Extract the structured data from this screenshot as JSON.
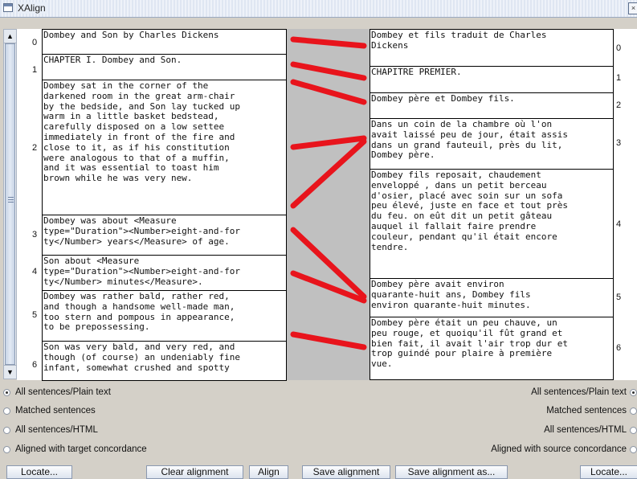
{
  "window": {
    "title": "XAlign"
  },
  "source": {
    "numbers": [
      "0",
      "1",
      "2",
      "3",
      "4",
      "5",
      "6"
    ],
    "sentences": [
      "Dombey and Son by Charles Dickens",
      "CHAPTER I. Dombey and Son.",
      "Dombey sat in the corner of the\ndarkened room in the great arm-chair\nby the bedside, and Son lay tucked up\nwarm in a little basket bedstead,\ncarefully disposed on a low settee\nimmediately in front of the fire and\nclose to it, as if his constitution\nwere analogous to that of a muffin,\nand it was essential to toast him\nbrown while he was very new.",
      "Dombey was about <Measure\ntype=\"Duration\"><Number>eight-and-for\nty</Number> years</Measure> of age.",
      "Son about <Measure\ntype=\"Duration\"><Number>eight-and-for\nty</Number> minutes</Measure>.",
      "Dombey was rather bald, rather red,\nand though a handsome well-made man,\ntoo stern and pompous in appearance,\nto be prepossessing.",
      "Son was very bald, and very red, and\nthough (of course) an undeniably fine\ninfant, somewhat crushed and spotty"
    ]
  },
  "target": {
    "numbers": [
      "0",
      "1",
      "2",
      "3",
      "4",
      "5",
      "6"
    ],
    "sentences": [
      "Dombey et fils traduit de Charles\nDickens",
      "CHAPITRE PREMIER.",
      "Dombey père et Dombey fils.",
      "Dans un coin de la chambre où l'on\navait laissé peu de jour, était assis\ndans un grand fauteuil, près du lit,\nDombey père.",
      "Dombey fils reposait, chaudement\nenveloppé , dans un petit berceau\nd'osier, placé avec soin sur un sofa\npeu élevé, juste en face et tout près\ndu feu. on eût dit un petit gâteau\nauquel il fallait faire prendre\ncouleur, pendant qu'il était encore\ntendre.",
      "Dombey père avait environ\nquarante-huit ans, Dombey fils\nenviron quarante-huit minutes.",
      "Dombey père était un peu chauve, un\npeu rouge, et quoiqu'il fût grand et\nbien fait, il avait l'air trop dur et\ntrop guindé pour plaire à première\nvue."
    ]
  },
  "alignment_color": "#e8141c",
  "options": {
    "left": [
      {
        "label": "All sentences/Plain text",
        "selected": true
      },
      {
        "label": "Matched sentences",
        "selected": false
      },
      {
        "label": "All sentences/HTML",
        "selected": false
      },
      {
        "label": "Aligned with target concordance",
        "selected": false
      }
    ],
    "right": [
      {
        "label": "All sentences/Plain text",
        "selected": true
      },
      {
        "label": "Matched sentences",
        "selected": false
      },
      {
        "label": "All sentences/HTML",
        "selected": false
      },
      {
        "label": "Aligned with source concordance",
        "selected": false
      }
    ]
  },
  "buttons": {
    "locate_left": "Locate...",
    "clear": "Clear alignment",
    "align": "Align",
    "save": "Save alignment",
    "save_as": "Save alignment as...",
    "locate_right": "Locate..."
  }
}
